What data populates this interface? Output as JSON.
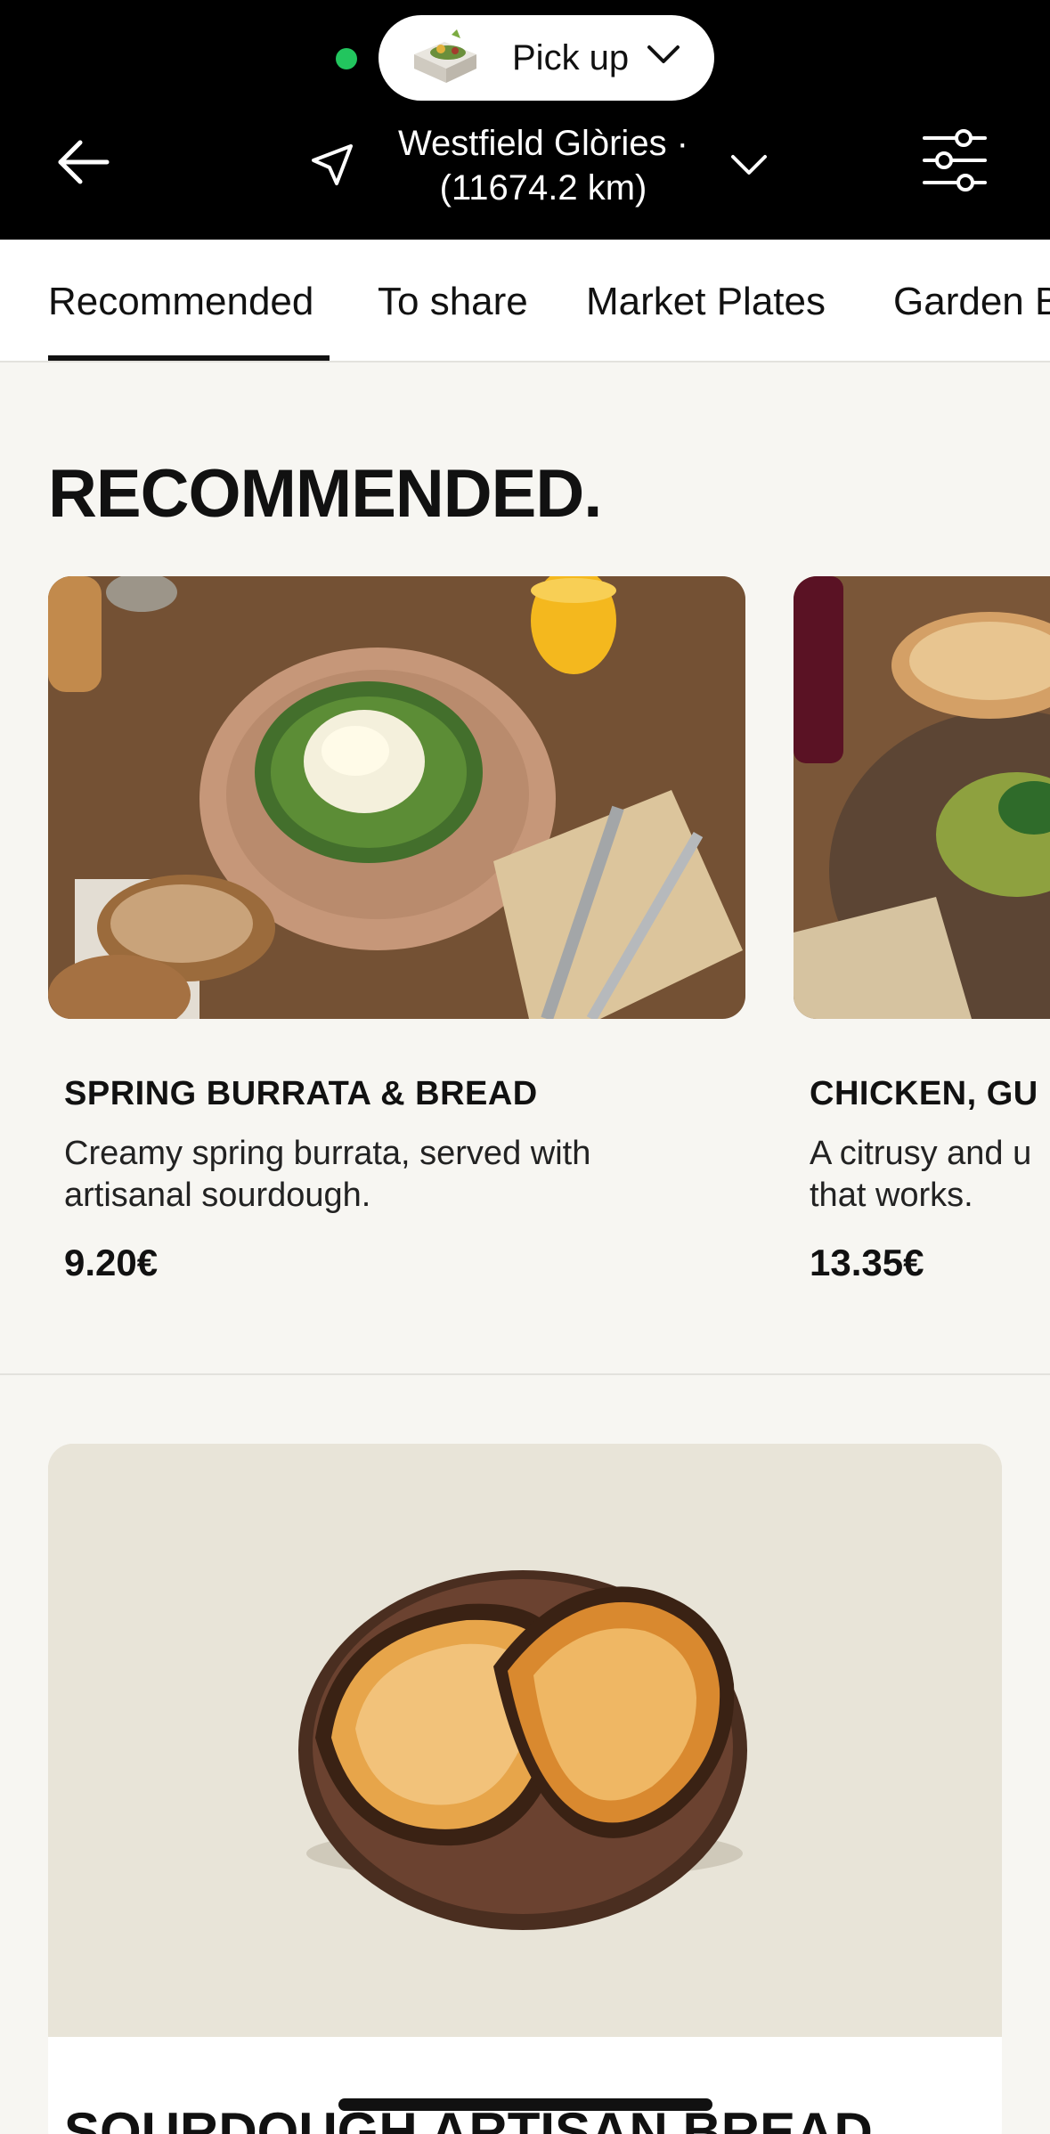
{
  "header": {
    "pickup_label": "Pick up",
    "location_line1": "Westfield Glòries ·",
    "location_line2": "(11674.2 km)",
    "status_color": "#22c55e"
  },
  "tabs": [
    {
      "label": "Recommended",
      "active": true
    },
    {
      "label": "To share",
      "active": false
    },
    {
      "label": "Market Plates",
      "active": false
    },
    {
      "label": "Garden B",
      "active": false
    }
  ],
  "section": {
    "title": "RECOMMENDED."
  },
  "cards": [
    {
      "title": "SPRING BURRATA & BREAD",
      "desc_line1": "Creamy spring burrata, served with",
      "desc_line2": "artisanal sourdough.",
      "price": "9.20€"
    },
    {
      "title": "CHICKEN, GU",
      "desc_line1": "A citrusy and u",
      "desc_line2": "that works.",
      "price": "13.35€"
    }
  ],
  "feature": {
    "title": "SOURDOUGH ARTISAN BREAD"
  },
  "icons": {
    "back": "arrow-left-icon",
    "location": "navigation-arrow-icon",
    "chevron": "chevron-down-icon",
    "filter": "sliders-icon"
  }
}
